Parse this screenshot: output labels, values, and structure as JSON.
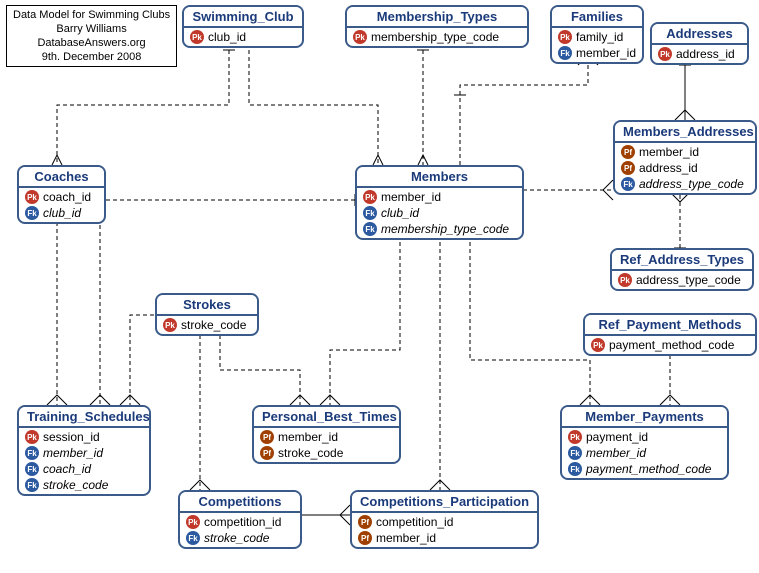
{
  "meta": {
    "line1": "Data Model for Swimming Clubs",
    "line2": "Barry Williams",
    "line3": "DatabaseAnswers.org",
    "line4": "9th. December 2008"
  },
  "entities": {
    "swimming_club": {
      "title": "Swimming_Club",
      "fields": [
        {
          "icon": "PK",
          "name": "club_id",
          "italic": false
        }
      ]
    },
    "membership_types": {
      "title": "Membership_Types",
      "fields": [
        {
          "icon": "PK",
          "name": "membership_type_code",
          "italic": false
        }
      ]
    },
    "families": {
      "title": "Families",
      "fields": [
        {
          "icon": "PK",
          "name": "family_id",
          "italic": false
        },
        {
          "icon": "FK",
          "name": "member_id",
          "italic": false
        }
      ]
    },
    "addresses": {
      "title": "Addresses",
      "fields": [
        {
          "icon": "PK",
          "name": "address_id",
          "italic": false
        }
      ]
    },
    "members_addresses": {
      "title": "Members_Addresses",
      "fields": [
        {
          "icon": "PF",
          "name": "member_id",
          "italic": false
        },
        {
          "icon": "PF",
          "name": "address_id",
          "italic": false
        },
        {
          "icon": "FK",
          "name": "address_type_code",
          "italic": true
        }
      ]
    },
    "coaches": {
      "title": "Coaches",
      "fields": [
        {
          "icon": "PK",
          "name": "coach_id",
          "italic": false
        },
        {
          "icon": "FK",
          "name": "club_id",
          "italic": true
        }
      ]
    },
    "members": {
      "title": "Members",
      "fields": [
        {
          "icon": "PK",
          "name": "member_id",
          "italic": false
        },
        {
          "icon": "FK",
          "name": "club_id",
          "italic": true
        },
        {
          "icon": "FK",
          "name": "membership_type_code",
          "italic": true
        }
      ]
    },
    "ref_address_types": {
      "title": "Ref_Address_Types",
      "fields": [
        {
          "icon": "PK",
          "name": "address_type_code",
          "italic": false
        }
      ]
    },
    "strokes": {
      "title": "Strokes",
      "fields": [
        {
          "icon": "PK",
          "name": "stroke_code",
          "italic": false
        }
      ]
    },
    "ref_payment_methods": {
      "title": "Ref_Payment_Methods",
      "fields": [
        {
          "icon": "PK",
          "name": "payment_method_code",
          "italic": false
        }
      ]
    },
    "training_schedules": {
      "title": "Training_Schedules",
      "fields": [
        {
          "icon": "PK",
          "name": "session_id",
          "italic": false
        },
        {
          "icon": "FK",
          "name": "member_id",
          "italic": true
        },
        {
          "icon": "FK",
          "name": "coach_id",
          "italic": true
        },
        {
          "icon": "FK",
          "name": "stroke_code",
          "italic": true
        }
      ]
    },
    "personal_best_times": {
      "title": "Personal_Best_Times",
      "fields": [
        {
          "icon": "PF",
          "name": "member_id",
          "italic": false
        },
        {
          "icon": "PF",
          "name": "stroke_code",
          "italic": false
        }
      ]
    },
    "member_payments": {
      "title": "Member_Payments",
      "fields": [
        {
          "icon": "PK",
          "name": "payment_id",
          "italic": false
        },
        {
          "icon": "FK",
          "name": "member_id",
          "italic": true
        },
        {
          "icon": "FK",
          "name": "payment_method_code",
          "italic": true
        }
      ]
    },
    "competitions": {
      "title": "Competitions",
      "fields": [
        {
          "icon": "PK",
          "name": "competition_id",
          "italic": false
        },
        {
          "icon": "FK",
          "name": "stroke_code",
          "italic": true
        }
      ]
    },
    "competitions_participation": {
      "title": "Competitions_Participation",
      "fields": [
        {
          "icon": "PF",
          "name": "competition_id",
          "italic": false
        },
        {
          "icon": "PF",
          "name": "member_id",
          "italic": false
        }
      ]
    }
  },
  "icon_labels": {
    "PK": "Pk",
    "FK": "Fk",
    "PF": "Pf"
  }
}
